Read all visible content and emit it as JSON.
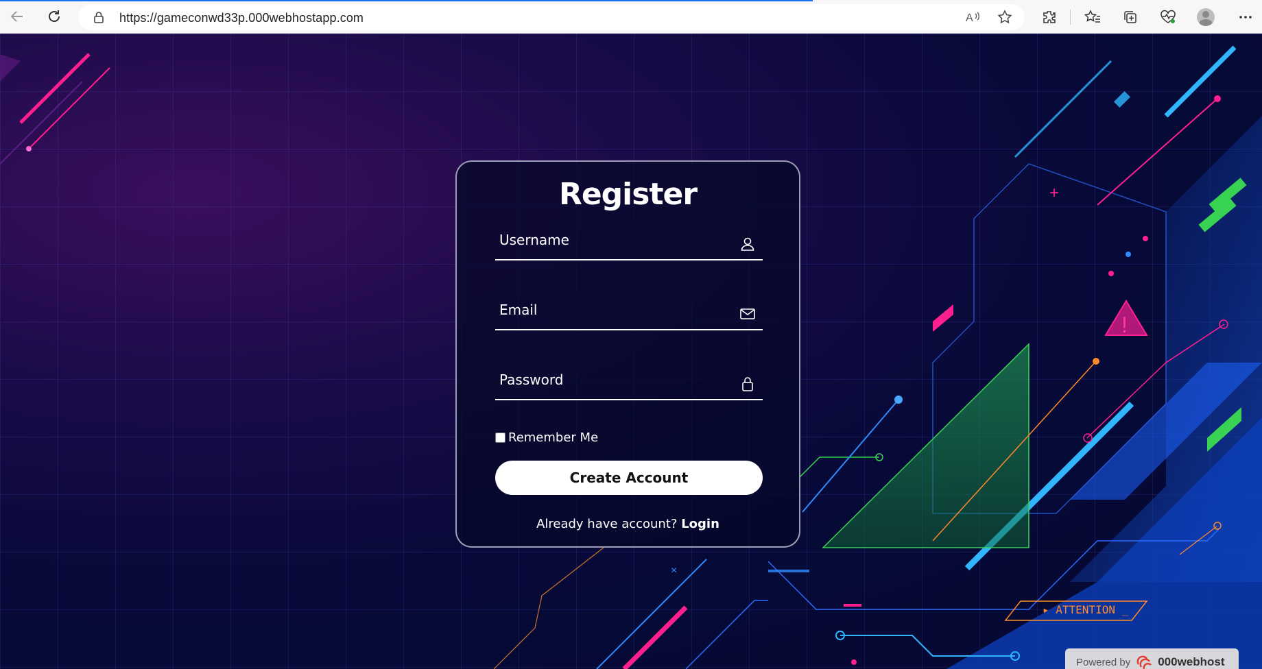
{
  "browser": {
    "url": "https://gameconwd33p.000webhostapp.com"
  },
  "form": {
    "title": "Register",
    "username_placeholder": "Username",
    "email_placeholder": "Email",
    "password_placeholder": "Password",
    "remember_label": "Remember Me",
    "remember_checked": false,
    "submit_label": "Create Account",
    "login_prompt": "Already have account?",
    "login_link": "Login"
  },
  "background": {
    "attention_text": "▸ ATTENTION _"
  },
  "footer": {
    "powered_by": "Powered by",
    "brand": "000webhost"
  },
  "colors": {
    "accent_pink": "#ff1f8e",
    "accent_blue": "#1a8cff",
    "accent_green": "#39d353",
    "accent_orange": "#ff8a2a"
  }
}
